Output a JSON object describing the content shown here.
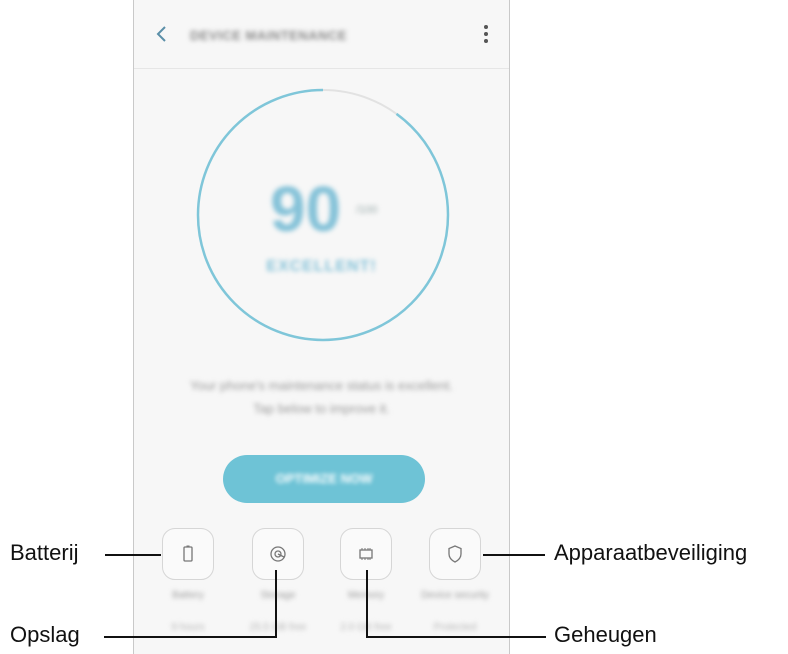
{
  "header": {
    "title": "DEVICE MAINTENANCE",
    "back_icon": "chevron-left-icon",
    "menu_icon": "more-vertical-icon"
  },
  "gauge": {
    "score": "90",
    "total": "/100",
    "label": "EXCELLENT!",
    "progress": 0.9,
    "ring_color": "#7fc6d9"
  },
  "status": {
    "line1": "Your phone's maintenance status is excellent.",
    "line2": "Tap below to improve it."
  },
  "optimize_button": {
    "label": "OPTIMIZE NOW",
    "color": "#6ec3d6"
  },
  "categories": [
    {
      "icon": "battery-icon",
      "label": "Battery",
      "value": "9 hours"
    },
    {
      "icon": "storage-icon",
      "label": "Storage",
      "value": "25.5 GB free"
    },
    {
      "icon": "memory-icon",
      "label": "Memory",
      "value": "2.0 GB free"
    },
    {
      "icon": "shield-icon",
      "label": "Device security",
      "value": "Protected"
    }
  ],
  "callouts": {
    "battery": "Batterij",
    "storage": "Opslag",
    "memory": "Geheugen",
    "security": "Apparaatbeveiliging"
  }
}
